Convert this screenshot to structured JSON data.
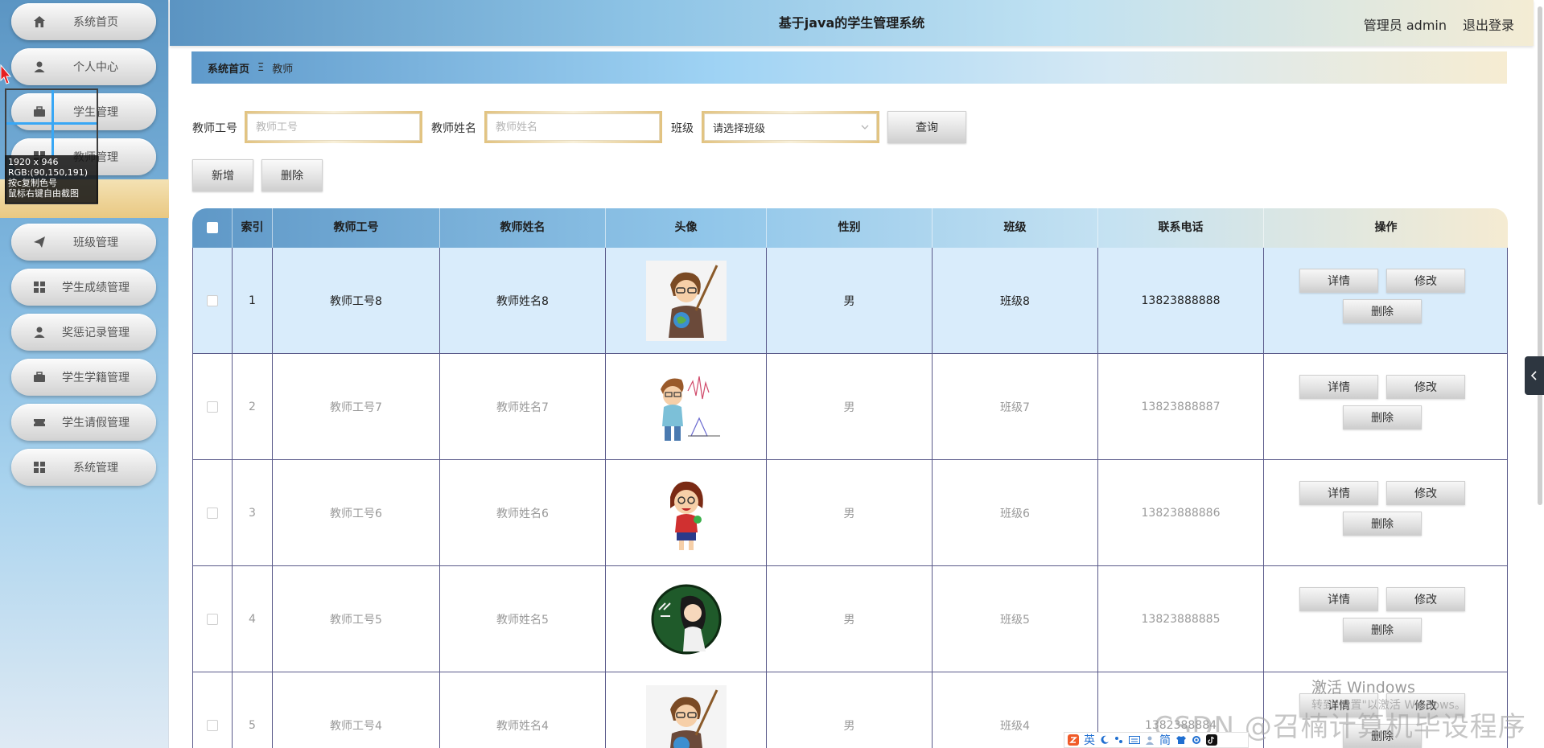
{
  "header": {
    "title": "基于java的学生管理系统",
    "user": "管理员 admin",
    "logout": "退出登录"
  },
  "sidebar": {
    "items": [
      {
        "label": "系统首页",
        "icon": "home-icon"
      },
      {
        "label": "个人中心",
        "icon": "user-icon"
      },
      {
        "label": "学生管理",
        "icon": "briefcase-icon"
      },
      {
        "label": "教师管理",
        "icon": "grid-icon"
      },
      {
        "label": "",
        "icon": ""
      },
      {
        "label": "班级管理",
        "icon": "send-icon"
      },
      {
        "label": "学生成绩管理",
        "icon": "grid-icon"
      },
      {
        "label": "奖惩记录管理",
        "icon": "user-icon"
      },
      {
        "label": "学生学籍管理",
        "icon": "briefcase-icon"
      },
      {
        "label": "学生请假管理",
        "icon": "ticket-icon"
      },
      {
        "label": "系统管理",
        "icon": "grid-icon"
      }
    ]
  },
  "capture_overlay": {
    "size": "1920 x 946",
    "rgb": "RGB:(90,150,191)",
    "copy_hint": "按c复制色号",
    "right_click_hint": "鼠标右键自由截图"
  },
  "breadcrumb": {
    "home": "系统首页",
    "separator": "Ξ",
    "current": "教师"
  },
  "search": {
    "teacher_no_label": "教师工号",
    "teacher_no_placeholder": "教师工号",
    "teacher_name_label": "教师姓名",
    "teacher_name_placeholder": "教师姓名",
    "class_label": "班级",
    "class_placeholder": "请选择班级",
    "query_button": "查询"
  },
  "actions": {
    "add": "新增",
    "delete": "删除"
  },
  "table": {
    "columns": [
      "索引",
      "教师工号",
      "教师姓名",
      "头像",
      "性别",
      "班级",
      "联系电话",
      "操作"
    ],
    "op_detail": "详情",
    "op_edit": "修改",
    "op_delete": "删除",
    "rows": [
      {
        "index": "1",
        "no": "教师工号8",
        "name": "教师姓名8",
        "avatar": "teacher-pointer-avatar",
        "gender": "男",
        "class": "班级8",
        "phone": "13823888888",
        "selected": true
      },
      {
        "index": "2",
        "no": "教师工号7",
        "name": "教师姓名7",
        "avatar": "teacher-math-avatar",
        "gender": "男",
        "class": "班级7",
        "phone": "13823888887",
        "selected": false
      },
      {
        "index": "3",
        "no": "教师工号6",
        "name": "教师姓名6",
        "avatar": "teacher-cheer-avatar",
        "gender": "男",
        "class": "班级6",
        "phone": "13823888886",
        "selected": false
      },
      {
        "index": "4",
        "no": "教师工号5",
        "name": "教师姓名5",
        "avatar": "teacher-blackboard-avatar",
        "gender": "男",
        "class": "班级5",
        "phone": "13823888885",
        "selected": false
      },
      {
        "index": "5",
        "no": "教师工号4",
        "name": "教师姓名4",
        "avatar": "teacher-pointer-avatar",
        "gender": "男",
        "class": "班级4",
        "phone": "1382388884",
        "selected": false
      }
    ]
  },
  "watermark": {
    "activate": "激活 Windows",
    "activate_hint": "转到\"设置\"以激活 Windows。",
    "csdn": "CSDN @召楠计算机毕设程序"
  },
  "ime": {
    "lang": "英",
    "simplified": "简"
  },
  "colors": {
    "accent_blue": "#5a96bf",
    "accent_gold": "#e2c381",
    "selected_row": "#d9ecfb"
  }
}
